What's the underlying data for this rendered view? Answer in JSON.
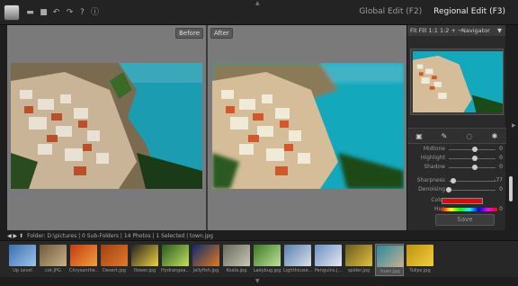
{
  "app": {
    "top_arrow": "▲",
    "bottom_arrow": "▼",
    "right_arrow": "▶",
    "edit_tabs": {
      "global": "Global Edit (F2)",
      "regional": "Regional Edit (F3)"
    }
  },
  "toolbar": [
    {
      "name": "folder-icon",
      "glyph": "▬"
    },
    {
      "name": "save-icon",
      "glyph": "■"
    },
    {
      "name": "undo-icon",
      "glyph": "↶"
    },
    {
      "name": "redo-icon",
      "glyph": "↷"
    },
    {
      "name": "help-icon",
      "glyph": "?"
    },
    {
      "name": "info-icon",
      "glyph": "ⓘ"
    }
  ],
  "canvas": {
    "before_label": "Before",
    "after_label": "After"
  },
  "navigator": {
    "zoom_controls": "Fit  Fill  1:1  1:2  +  −",
    "title": "Navigator",
    "collapse": "▼"
  },
  "tools": [
    {
      "name": "gradient-tool-icon",
      "glyph": "▣"
    },
    {
      "name": "brush-tool-icon",
      "glyph": "✎"
    },
    {
      "name": "lasso-tool-icon",
      "glyph": "◌"
    },
    {
      "name": "magic-wand-tool-icon",
      "glyph": "✱"
    }
  ],
  "adjustments": [
    {
      "label": "Midtone",
      "value": "0",
      "knob": 0.55
    },
    {
      "label": "Highlight",
      "value": "0",
      "knob": 0.55
    },
    {
      "label": "Shadow",
      "value": "0",
      "knob": 0.55
    },
    {
      "label": "Sharpness",
      "value": "-77",
      "knob": 0.1
    },
    {
      "label": "Denoising",
      "value": "0",
      "knob": 0.0
    }
  ],
  "color": {
    "label": "Color",
    "swatch": "#d01010",
    "hue_label": "Hue",
    "hue_value": "0"
  },
  "save_label": "Save",
  "infobar": {
    "text": "Folder: D:\\pictures | 0 Sub-Folders | 14 Photos | 1 Selected | town.jpg"
  },
  "filmstrip": [
    {
      "caption": "Up Level",
      "colors": [
        "#3a6fb0",
        "#9fc3e8"
      ],
      "selected": false
    },
    {
      "caption": "cat.JPG",
      "colors": [
        "#6e5a3c",
        "#c9b089"
      ],
      "selected": false
    },
    {
      "caption": "Chrysanthe...",
      "colors": [
        "#c23a10",
        "#f0a040"
      ],
      "selected": false
    },
    {
      "caption": "Desert.jpg",
      "colors": [
        "#a04010",
        "#e07a30"
      ],
      "selected": false
    },
    {
      "caption": "flower.jpg",
      "colors": [
        "#222",
        "#f0d040"
      ],
      "selected": false
    },
    {
      "caption": "Hydrangea...",
      "colors": [
        "#2a5a20",
        "#c0e060"
      ],
      "selected": false
    },
    {
      "caption": "Jellyfish.jpg",
      "colors": [
        "#0a2a70",
        "#e07a20"
      ],
      "selected": false
    },
    {
      "caption": "Koala.jpg",
      "colors": [
        "#6a6a5a",
        "#c8c8b8"
      ],
      "selected": false
    },
    {
      "caption": "Ladybug.jpg",
      "colors": [
        "#3a7a20",
        "#c0e0a0"
      ],
      "selected": false
    },
    {
      "caption": "Lighthouse...",
      "colors": [
        "#5a80b0",
        "#d8e0e8"
      ],
      "selected": false
    },
    {
      "caption": "Penguins.j...",
      "colors": [
        "#6a90c0",
        "#e8e8f0"
      ],
      "selected": false
    },
    {
      "caption": "spider.jpg",
      "colors": [
        "#6a5a20",
        "#e0c040"
      ],
      "selected": false
    },
    {
      "caption": "town.jpg",
      "colors": [
        "#2a8aa0",
        "#c8b090"
      ],
      "selected": true
    },
    {
      "caption": "Tulips.jpg",
      "colors": [
        "#c09010",
        "#f0d040"
      ],
      "selected": false
    }
  ]
}
